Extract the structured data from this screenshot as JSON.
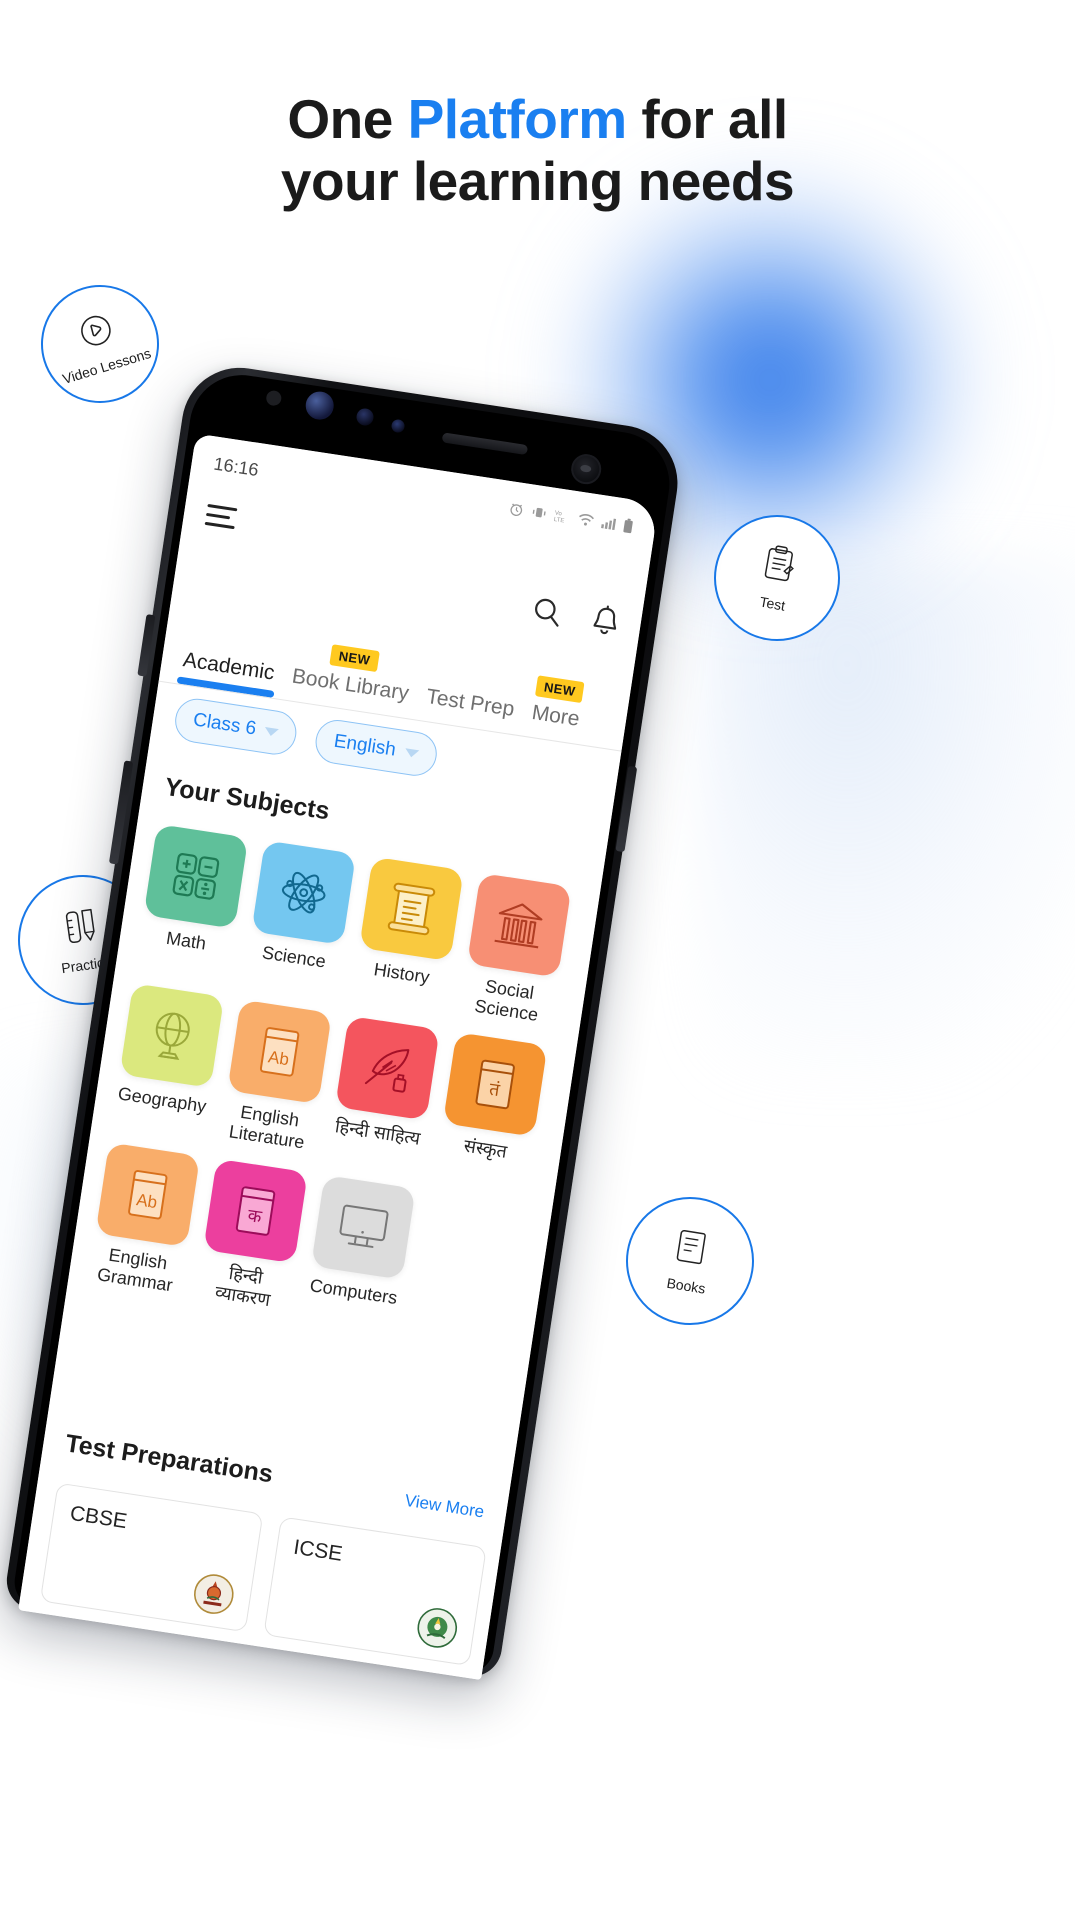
{
  "headline": {
    "line1_a": "One ",
    "line1_blue": "Platform",
    "line1_b": " for all",
    "line2": "your learning needs",
    "accent_color": "#1a7ff0"
  },
  "floating_badges": [
    {
      "id": "video",
      "label": "Video Lessons",
      "icon": "play-circle-icon"
    },
    {
      "id": "test",
      "label": "Test",
      "icon": "clipboard-test-icon"
    },
    {
      "id": "practice",
      "label": "Practice",
      "icon": "pencil-ruler-icon"
    },
    {
      "id": "books",
      "label": "Books",
      "icon": "book-icon"
    }
  ],
  "phone": {
    "status_bar": {
      "time": "16:16",
      "icons": [
        "alarm-icon",
        "vibrate-icon",
        "volte-icon",
        "wifi-icon",
        "signal-icon",
        "battery-icon"
      ]
    },
    "app_bar": {
      "menu_icon": "hamburger-icon",
      "search_icon": "search-icon",
      "notification_icon": "bell-icon"
    },
    "tabs": [
      {
        "label": "Academic",
        "active": true,
        "badge": ""
      },
      {
        "label": "Book Library",
        "active": false,
        "badge": "NEW"
      },
      {
        "label": "Test Prep",
        "active": false,
        "badge": ""
      },
      {
        "label": "More",
        "active": false,
        "badge": "NEW"
      }
    ],
    "filters": [
      {
        "value": "Class 6"
      },
      {
        "value": "English"
      }
    ],
    "sections": {
      "subjects_title": "Your Subjects",
      "test_prep_title": "Test Preparations",
      "view_more": "View More"
    },
    "subjects": [
      {
        "name": "Math",
        "icon": "calculator-icon",
        "bg": "#5fc09a",
        "ink": "#1e7a54"
      },
      {
        "name": "Science",
        "icon": "atom-icon",
        "bg": "#74c7f0",
        "ink": "#11688f"
      },
      {
        "name": "History",
        "icon": "scroll-icon",
        "bg": "#f9c93f",
        "ink": "#c98a07"
      },
      {
        "name": "Social Science",
        "icon": "bank-icon",
        "bg": "#f78f74",
        "ink": "#b03d23"
      },
      {
        "name": "Geography",
        "icon": "globe-icon",
        "bg": "#dbe87e",
        "ink": "#9aa83a"
      },
      {
        "name": "English Literature",
        "icon": "ab-book-icon",
        "bg": "#f9ad6a",
        "ink": "#d7701c"
      },
      {
        "name": "हिन्दी साहित्य",
        "icon": "quill-icon",
        "bg": "#f4555e",
        "ink": "#a41027"
      },
      {
        "name": "संस्कृत",
        "icon": "sanskrit-book-icon",
        "bg": "#f59431",
        "ink": "#a8500a"
      },
      {
        "name": "English Grammar",
        "icon": "ab-book-icon",
        "bg": "#f9ad6a",
        "ink": "#d7701c"
      },
      {
        "name": "हिन्दी व्याकरण",
        "icon": "hindi-book-icon",
        "bg": "#ec3f9e",
        "ink": "#9c0c5a"
      },
      {
        "name": "Computers",
        "icon": "monitor-icon",
        "bg": "#dcdcdc",
        "ink": "#777777"
      }
    ],
    "test_prep_cards": [
      {
        "name": "CBSE",
        "emblem": "cbse-emblem-icon"
      },
      {
        "name": "ICSE",
        "emblem": "icse-emblem-icon"
      }
    ]
  }
}
